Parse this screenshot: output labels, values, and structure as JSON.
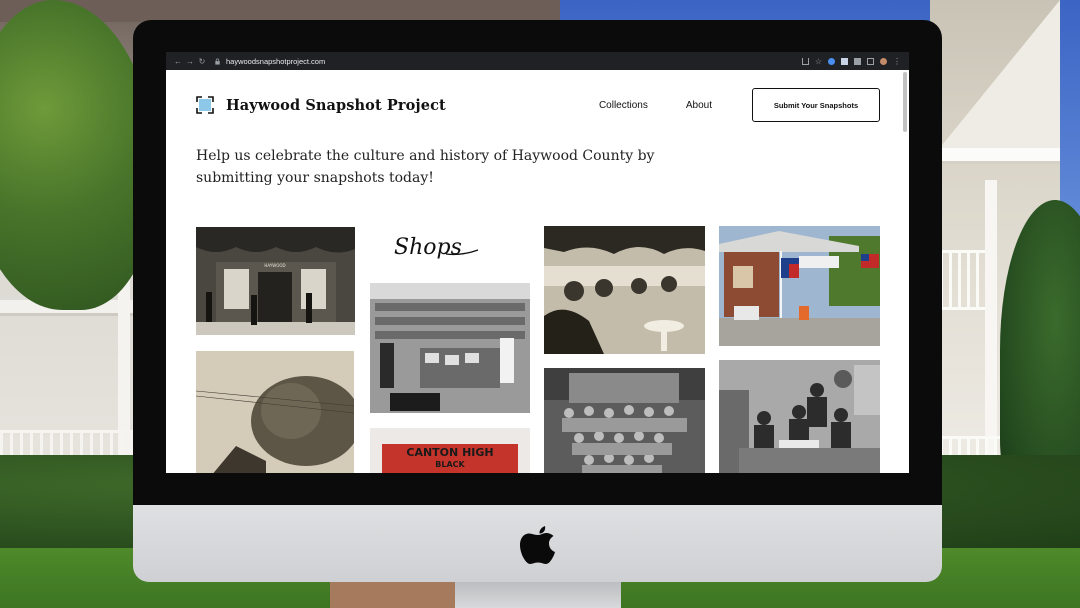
{
  "browser": {
    "url": "haywoodsnapshotproject.com"
  },
  "site": {
    "title": "Haywood Snapshot Project",
    "nav": [
      {
        "label": "Collections"
      },
      {
        "label": "About"
      }
    ],
    "cta_label": "Submit Your Snapshots",
    "hero_text": "Help us celebrate the culture and history of Haywood County by submitting your snapshots today!"
  },
  "gallery": {
    "shops_label": "Shops",
    "canton_sign_line1": "CANTON HIGH",
    "canton_sign_line2": "BLACK",
    "storefront_sign": "HAYWOOD"
  },
  "colors": {
    "cta_border": "#111111",
    "chrome_bg": "#202124",
    "logo_accent": "#8ec8e8"
  },
  "icons": [
    "back-icon",
    "forward-icon",
    "reload-icon",
    "lock-icon",
    "share-icon",
    "bookmark-star-icon",
    "extension-icon",
    "puzzle-icon",
    "sidebar-icon",
    "profile-icon",
    "menu-icon",
    "apple-logo-icon"
  ]
}
